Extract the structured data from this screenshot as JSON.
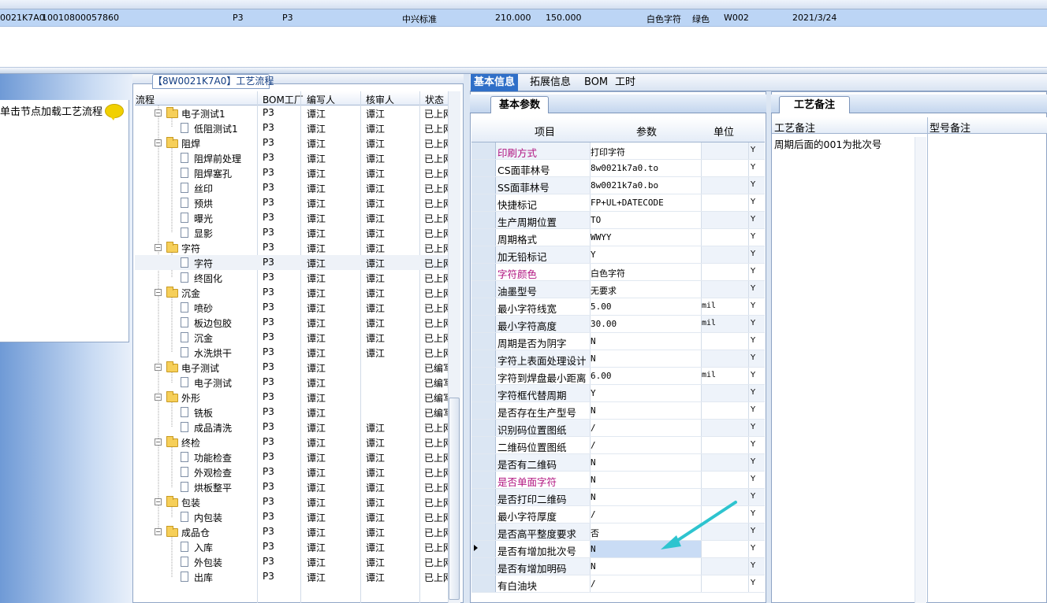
{
  "top_grid": {
    "row": {
      "col_a": "0021K7A0",
      "col_b": "10010800057860",
      "col_c": "P3",
      "col_d": "P3",
      "col_e": "中兴标准",
      "col_f": "210.000",
      "col_g": "150.000",
      "col_h": "白色字符",
      "col_i": "绿色",
      "col_j": "W002",
      "col_k": "2021/3/24"
    }
  },
  "left_panel": {
    "message": "单击节点加载工艺流程"
  },
  "flow": {
    "tab_label": "【8W0021K7A0】工艺流程",
    "columns": {
      "process": "流程",
      "bom_factory": "BOM工厂",
      "writer": "编写人",
      "reviewer": "核审人",
      "status": "状态"
    },
    "rows": [
      {
        "name": "电子测试1",
        "bom": "P3",
        "writer": "谭江",
        "reviewer": "谭江",
        "status": "已上网"
      },
      {
        "name": "低阻测试1",
        "bom": "P3",
        "writer": "谭江",
        "reviewer": "谭江",
        "status": "已上网"
      },
      {
        "name": "阻焊",
        "bom": "P3",
        "writer": "谭江",
        "reviewer": "谭江",
        "status": "已上网"
      },
      {
        "name": "阻焊前处理",
        "bom": "P3",
        "writer": "谭江",
        "reviewer": "谭江",
        "status": "已上网"
      },
      {
        "name": "阻焊塞孔",
        "bom": "P3",
        "writer": "谭江",
        "reviewer": "谭江",
        "status": "已上网"
      },
      {
        "name": "丝印",
        "bom": "P3",
        "writer": "谭江",
        "reviewer": "谭江",
        "status": "已上网"
      },
      {
        "name": "预烘",
        "bom": "P3",
        "writer": "谭江",
        "reviewer": "谭江",
        "status": "已上网"
      },
      {
        "name": "曝光",
        "bom": "P3",
        "writer": "谭江",
        "reviewer": "谭江",
        "status": "已上网"
      },
      {
        "name": "显影",
        "bom": "P3",
        "writer": "谭江",
        "reviewer": "谭江",
        "status": "已上网"
      },
      {
        "name": "字符",
        "bom": "P3",
        "writer": "谭江",
        "reviewer": "谭江",
        "status": "已上网"
      },
      {
        "name": "字符",
        "bom": "P3",
        "writer": "谭江",
        "reviewer": "谭江",
        "status": "已上网"
      },
      {
        "name": "终固化",
        "bom": "P3",
        "writer": "谭江",
        "reviewer": "谭江",
        "status": "已上网"
      },
      {
        "name": "沉金",
        "bom": "P3",
        "writer": "谭江",
        "reviewer": "谭江",
        "status": "已上网"
      },
      {
        "name": "喷砂",
        "bom": "P3",
        "writer": "谭江",
        "reviewer": "谭江",
        "status": "已上网"
      },
      {
        "name": "板边包胶",
        "bom": "P3",
        "writer": "谭江",
        "reviewer": "谭江",
        "status": "已上网"
      },
      {
        "name": "沉金",
        "bom": "P3",
        "writer": "谭江",
        "reviewer": "谭江",
        "status": "已上网"
      },
      {
        "name": "水洗烘干",
        "bom": "P3",
        "writer": "谭江",
        "reviewer": "谭江",
        "status": "已上网"
      },
      {
        "name": "电子测试",
        "bom": "P3",
        "writer": "谭江",
        "reviewer": "",
        "status": "已编写"
      },
      {
        "name": "电子测试",
        "bom": "P3",
        "writer": "谭江",
        "reviewer": "",
        "status": "已编写"
      },
      {
        "name": "外形",
        "bom": "P3",
        "writer": "谭江",
        "reviewer": "",
        "status": "已编写"
      },
      {
        "name": "铣板",
        "bom": "P3",
        "writer": "谭江",
        "reviewer": "",
        "status": "已编写"
      },
      {
        "name": "成品清洗",
        "bom": "P3",
        "writer": "谭江",
        "reviewer": "谭江",
        "status": "已上网"
      },
      {
        "name": "终检",
        "bom": "P3",
        "writer": "谭江",
        "reviewer": "谭江",
        "status": "已上网"
      },
      {
        "name": "功能检查",
        "bom": "P3",
        "writer": "谭江",
        "reviewer": "谭江",
        "status": "已上网"
      },
      {
        "name": "外观检查",
        "bom": "P3",
        "writer": "谭江",
        "reviewer": "谭江",
        "status": "已上网"
      },
      {
        "name": "烘板整平",
        "bom": "P3",
        "writer": "谭江",
        "reviewer": "谭江",
        "status": "已上网"
      },
      {
        "name": "包装",
        "bom": "P3",
        "writer": "谭江",
        "reviewer": "谭江",
        "status": "已上网"
      },
      {
        "name": "内包装",
        "bom": "P3",
        "writer": "谭江",
        "reviewer": "谭江",
        "status": "已上网"
      },
      {
        "name": "成品仓",
        "bom": "P3",
        "writer": "谭江",
        "reviewer": "谭江",
        "status": "已上网"
      },
      {
        "name": "入库",
        "bom": "P3",
        "writer": "谭江",
        "reviewer": "谭江",
        "status": "已上网"
      },
      {
        "name": "外包装",
        "bom": "P3",
        "writer": "谭江",
        "reviewer": "谭江",
        "status": "已上网"
      },
      {
        "name": "出库",
        "bom": "P3",
        "writer": "谭江",
        "reviewer": "谭江",
        "status": "已上网"
      }
    ]
  },
  "right_tabs": [
    "基本信息",
    "拓展信息",
    "BOM",
    "工时"
  ],
  "basic_params": {
    "tab_label": "基本参数",
    "columns": {
      "item": "项目",
      "param": "参数",
      "unit": "单位"
    },
    "rows": [
      {
        "item": "印刷方式",
        "param": "打印字符",
        "unit": "",
        "flag": "Y",
        "highlight": true
      },
      {
        "item": "CS面菲林号",
        "param": "8w0021k7a0.to",
        "unit": "",
        "flag": "Y",
        "highlight": false
      },
      {
        "item": "SS面菲林号",
        "param": "8w0021k7a0.bo",
        "unit": "",
        "flag": "Y",
        "highlight": false
      },
      {
        "item": "快捷标记",
        "param": "FP+UL+DATECODE",
        "unit": "",
        "flag": "Y",
        "highlight": false
      },
      {
        "item": "生产周期位置",
        "param": "TO",
        "unit": "",
        "flag": "Y",
        "highlight": false
      },
      {
        "item": "周期格式",
        "param": "WWYY",
        "unit": "",
        "flag": "Y",
        "highlight": false
      },
      {
        "item": "加无铅标记",
        "param": "Y",
        "unit": "",
        "flag": "Y",
        "highlight": false
      },
      {
        "item": "字符颜色",
        "param": "白色字符",
        "unit": "",
        "flag": "Y",
        "highlight": true
      },
      {
        "item": "油墨型号",
        "param": "无要求",
        "unit": "",
        "flag": "Y",
        "highlight": false
      },
      {
        "item": "最小字符线宽",
        "param": "5.00",
        "unit": "mil",
        "flag": "Y",
        "highlight": false
      },
      {
        "item": "最小字符高度",
        "param": "30.00",
        "unit": "mil",
        "flag": "Y",
        "highlight": false
      },
      {
        "item": "周期是否为阴字",
        "param": "N",
        "unit": "",
        "flag": "Y",
        "highlight": false
      },
      {
        "item": "字符上表面处理设计",
        "param": "N",
        "unit": "",
        "flag": "Y",
        "highlight": false
      },
      {
        "item": "字符到焊盘最小距离",
        "param": "6.00",
        "unit": "mil",
        "flag": "Y",
        "highlight": false
      },
      {
        "item": "字符框代替周期",
        "param": "Y",
        "unit": "",
        "flag": "Y",
        "highlight": false
      },
      {
        "item": "是否存在生产型号",
        "param": "N",
        "unit": "",
        "flag": "Y",
        "highlight": false
      },
      {
        "item": "识别码位置图纸",
        "param": "/",
        "unit": "",
        "flag": "Y",
        "highlight": false
      },
      {
        "item": "二维码位置图纸",
        "param": "/",
        "unit": "",
        "flag": "Y",
        "highlight": false
      },
      {
        "item": "是否有二维码",
        "param": "N",
        "unit": "",
        "flag": "Y",
        "highlight": false
      },
      {
        "item": "是否单面字符",
        "param": "N",
        "unit": "",
        "flag": "Y",
        "highlight": true
      },
      {
        "item": "是否打印二维码",
        "param": "N",
        "unit": "",
        "flag": "Y",
        "highlight": false
      },
      {
        "item": "最小字符厚度",
        "param": "/",
        "unit": "",
        "flag": "Y",
        "highlight": false
      },
      {
        "item": "是否高平整度要求",
        "param": "否",
        "unit": "",
        "flag": "Y",
        "highlight": false
      },
      {
        "item": "是否有增加批次号",
        "param": "N",
        "unit": "",
        "flag": "Y",
        "highlight": false
      },
      {
        "item": "是否有增加明码",
        "param": "N",
        "unit": "",
        "flag": "Y",
        "highlight": false
      },
      {
        "item": "有白油块",
        "param": "/",
        "unit": "",
        "flag": "Y",
        "highlight": false
      }
    ]
  },
  "remarks": {
    "tab_label": "工艺备注",
    "col_process": "工艺备注",
    "col_model": "型号备注",
    "note": "周期后面的001为批次号"
  },
  "colors": {
    "selection": "#bcd5f5",
    "active_tab": "#2f6fc8",
    "highlight_text": "#b0127f",
    "arrow": "#2ec4cf"
  }
}
